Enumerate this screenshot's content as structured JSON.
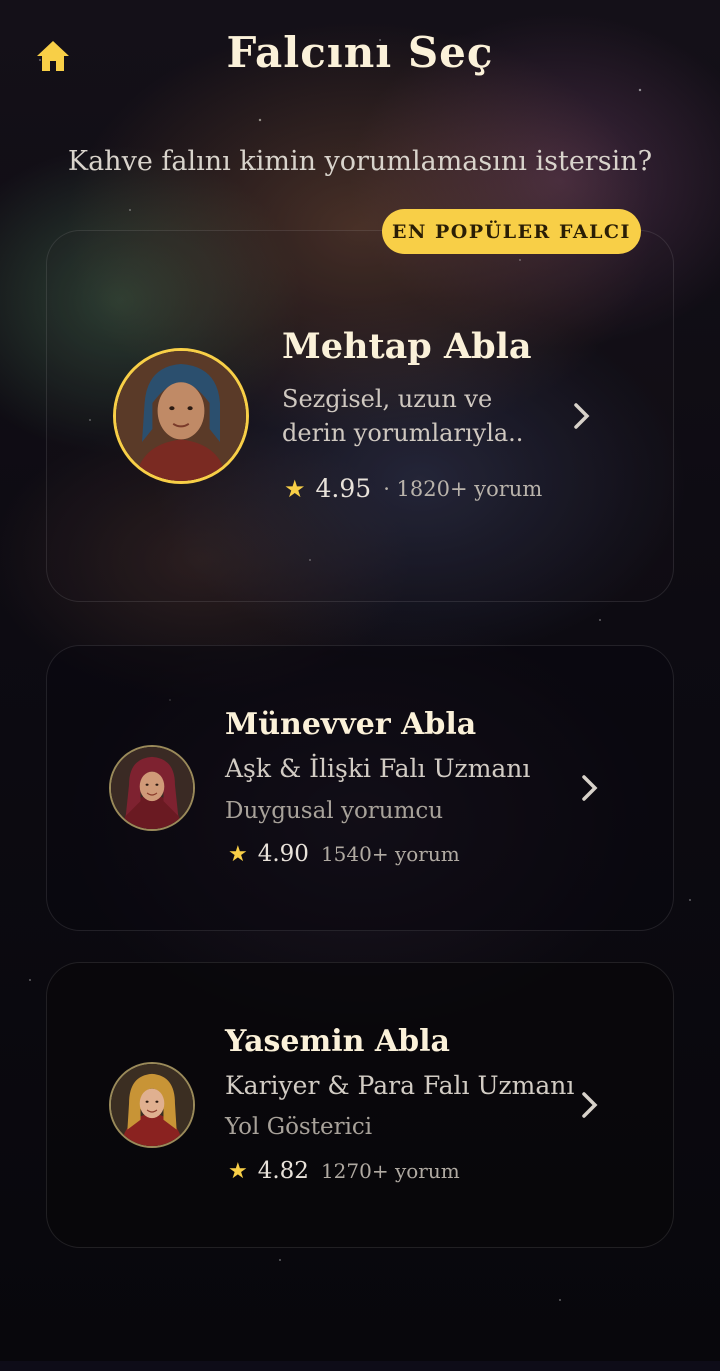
{
  "header": {
    "title": "Falcını Seç",
    "home_icon": "home-icon"
  },
  "subtitle": "Kahve falını kimin yorumlamasını istersin?",
  "featured_badge": "EN POPÜLER FALCI",
  "colors": {
    "accent": "#f8cf47",
    "title": "#fbf1d9",
    "text_muted": "#b9b3ab"
  },
  "readers": [
    {
      "name": "Mehtap Abla",
      "description_line1": "Sezgisel, uzun ve",
      "description_line2": "derin yorumlarıyla..",
      "rating": "4.95",
      "reviews": "· 1820+ yorum",
      "icon": "star-icon",
      "featured": true
    },
    {
      "name": "Münevver Abla",
      "specialty": "Aşk & İlişki Falı Uzmanı",
      "tagline": "Duygusal yorumcu",
      "rating": "4.90",
      "reviews": "1540+ yorum",
      "icon": "star-icon",
      "featured": false
    },
    {
      "name": "Yasemin Abla",
      "specialty": "Kariyer & Para Falı Uzmanı",
      "tagline": "Yol Gösterici",
      "rating": "4.82",
      "reviews": "1270+ yorum",
      "icon": "star-icon",
      "featured": false
    }
  ]
}
